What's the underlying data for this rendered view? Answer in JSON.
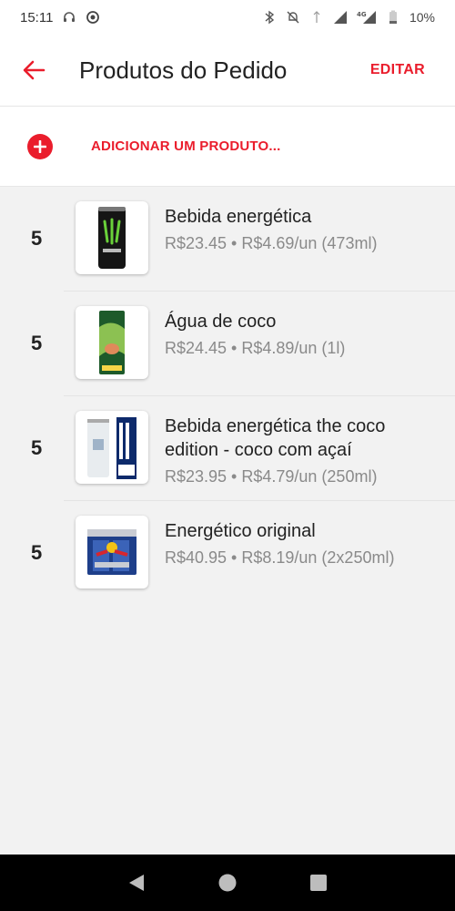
{
  "status_bar": {
    "time": "15:11",
    "battery": "10%",
    "network": "4G"
  },
  "app_bar": {
    "title": "Produtos do Pedido",
    "edit_label": "EDITAR"
  },
  "add_product": {
    "label": "ADICIONAR UM PRODUTO..."
  },
  "products": [
    {
      "quantity": "5",
      "name": "Bebida energética",
      "price": "R$23.45 • R$4.69/un (473ml)",
      "image": "monster-can-icon"
    },
    {
      "quantity": "5",
      "name": "Água de coco",
      "price": "R$24.45 • R$4.89/un (1l)",
      "image": "coconut-water-carton-icon"
    },
    {
      "quantity": "5",
      "name": "Bebida energética the coco edition - coco com açaí",
      "price": "R$23.95 • R$4.79/un (250ml)",
      "image": "redbull-coco-can-icon"
    },
    {
      "quantity": "5",
      "name": "Energético original",
      "price": "R$40.95 • R$8.19/un (2x250ml)",
      "image": "redbull-pack-icon"
    }
  ],
  "colors": {
    "accent": "#ea1d2c",
    "background": "#f2f2f2"
  }
}
